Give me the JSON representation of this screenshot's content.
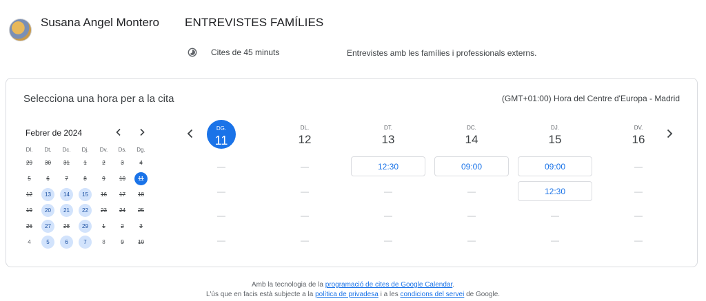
{
  "host": {
    "name": "Susana Angel Montero"
  },
  "event": {
    "title": "ENTREVISTES FAMÍLIES",
    "duration": "Cites de 45 minuts",
    "description": "Entrevistes amb les famílies i professionals externs."
  },
  "card": {
    "title": "Selecciona una hora per a la cita",
    "timezone": "(GMT+01:00) Hora del Centre d'Europa - Madrid"
  },
  "mini_calendar": {
    "month": "Febrer de 2024",
    "weekdays": [
      "Dl.",
      "Dt.",
      "Dc.",
      "Dj.",
      "Dv.",
      "Ds.",
      "Dg."
    ],
    "weeks": [
      [
        {
          "d": "29",
          "s": "past"
        },
        {
          "d": "30",
          "s": "past"
        },
        {
          "d": "31",
          "s": "past"
        },
        {
          "d": "1",
          "s": "past"
        },
        {
          "d": "2",
          "s": "past"
        },
        {
          "d": "3",
          "s": "past"
        },
        {
          "d": "4",
          "s": "past"
        }
      ],
      [
        {
          "d": "5",
          "s": "past"
        },
        {
          "d": "6",
          "s": "past"
        },
        {
          "d": "7",
          "s": "past"
        },
        {
          "d": "8",
          "s": "past"
        },
        {
          "d": "9",
          "s": "past"
        },
        {
          "d": "10",
          "s": "past"
        },
        {
          "d": "11",
          "s": "today"
        }
      ],
      [
        {
          "d": "12",
          "s": "past"
        },
        {
          "d": "13",
          "s": "avail"
        },
        {
          "d": "14",
          "s": "avail"
        },
        {
          "d": "15",
          "s": "avail"
        },
        {
          "d": "16",
          "s": "past"
        },
        {
          "d": "17",
          "s": "past"
        },
        {
          "d": "18",
          "s": "past"
        }
      ],
      [
        {
          "d": "19",
          "s": "past"
        },
        {
          "d": "20",
          "s": "avail"
        },
        {
          "d": "21",
          "s": "avail"
        },
        {
          "d": "22",
          "s": "avail"
        },
        {
          "d": "23",
          "s": "past"
        },
        {
          "d": "24",
          "s": "past"
        },
        {
          "d": "25",
          "s": "past"
        }
      ],
      [
        {
          "d": "26",
          "s": "past"
        },
        {
          "d": "27",
          "s": "avail"
        },
        {
          "d": "28",
          "s": "past"
        },
        {
          "d": "29",
          "s": "avail"
        },
        {
          "d": "1",
          "s": "past"
        },
        {
          "d": "2",
          "s": "past"
        },
        {
          "d": "3",
          "s": "past"
        }
      ],
      [
        {
          "d": "4",
          "s": "other"
        },
        {
          "d": "5",
          "s": "avail"
        },
        {
          "d": "6",
          "s": "avail"
        },
        {
          "d": "7",
          "s": "avail"
        },
        {
          "d": "8",
          "s": "other"
        },
        {
          "d": "9",
          "s": "past"
        },
        {
          "d": "10",
          "s": "past"
        }
      ]
    ]
  },
  "week": {
    "days": [
      {
        "dow": "DG.",
        "num": "11",
        "selected": true,
        "slots": [
          "",
          "",
          "",
          ""
        ]
      },
      {
        "dow": "DL.",
        "num": "12",
        "selected": false,
        "slots": [
          "",
          "",
          "",
          ""
        ]
      },
      {
        "dow": "DT.",
        "num": "13",
        "selected": false,
        "slots": [
          "12:30",
          "",
          "",
          ""
        ]
      },
      {
        "dow": "DC.",
        "num": "14",
        "selected": false,
        "slots": [
          "09:00",
          "",
          "",
          ""
        ]
      },
      {
        "dow": "DJ.",
        "num": "15",
        "selected": false,
        "slots": [
          "09:00",
          "12:30",
          "",
          ""
        ]
      },
      {
        "dow": "DV.",
        "num": "16",
        "selected": false,
        "slots": [
          "",
          "",
          "",
          ""
        ]
      }
    ],
    "empty_slot": "—"
  },
  "footer": {
    "line1_prefix": "Amb la tecnologia de la ",
    "line1_link": "programació de cites de Google Calendar",
    "line1_suffix": ".",
    "line2_prefix": "L'ús que en facis està subjecte a la ",
    "line2_link1": "política de privadesa",
    "line2_mid": " i a les ",
    "line2_link2": "condicions del servei",
    "line2_suffix": " de Google."
  },
  "icons": {
    "prev": "chevron-left-icon",
    "next": "chevron-right-icon",
    "duration": "clock-icon"
  },
  "colors": {
    "accent": "#1a73e8",
    "available_bg": "#d2e3fc"
  }
}
